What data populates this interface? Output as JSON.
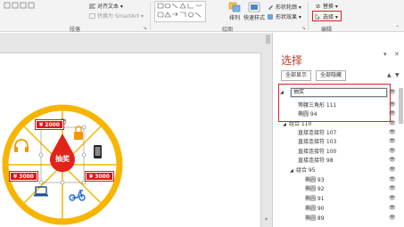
{
  "ribbon": {
    "align_text_label": "对齐文本",
    "convert_smartart_label": "转换为 SmartArt",
    "paragraph_group": "段落",
    "drawing_group": "绘图",
    "arrange_label": "排列",
    "quick_styles_label": "快速样式",
    "shape_outline_label": "形状轮廓",
    "shape_effects_label": "形状效果",
    "replace_label": "替换",
    "select_label": "选择",
    "editing_group": "编辑"
  },
  "slide": {
    "center_text": "抽奖",
    "tags": [
      "¥ 2000",
      "¥ 3000",
      "¥ 3000"
    ],
    "colors": {
      "ring": "#f7b500",
      "red": "#e2231a",
      "orange": "#f39800",
      "dark": "#222222",
      "blue": "#1f6fd1"
    }
  },
  "pane": {
    "title": "选择",
    "show_all": "全部显示",
    "hide_all": "全部隐藏",
    "items": [
      {
        "label": "抽奖",
        "editing": true
      },
      {
        "label": "等腰三角形 111"
      },
      {
        "label": "椭圆 94"
      },
      {
        "label": "组合 110"
      },
      {
        "label": "直接连接符 107"
      },
      {
        "label": "直接连接符 103"
      },
      {
        "label": "直接连接符 100"
      },
      {
        "label": "直接连接符 98"
      },
      {
        "label": "组合 95"
      },
      {
        "label": "椭圆 93"
      },
      {
        "label": "椭圆 92"
      },
      {
        "label": "椭圆 91"
      },
      {
        "label": "椭圆 90"
      },
      {
        "label": "椭圆 89"
      }
    ]
  }
}
